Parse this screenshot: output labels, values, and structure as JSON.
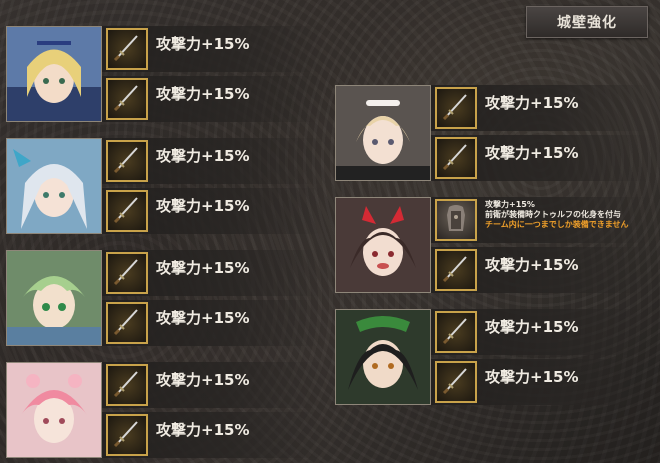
{
  "header": {
    "title": "城壁強化"
  },
  "colors": {
    "accent_gold": "#c8a24a",
    "warning_orange": "#f0a02a",
    "text_light": "#f0ebe2"
  },
  "slot_icon": "sword-icon",
  "left_cards": [
    {
      "name": "blonde-knight",
      "rows": [
        {
          "bonus": "攻撃力+15%"
        },
        {
          "bonus": "攻撃力+15%"
        }
      ]
    },
    {
      "name": "silver-hair-girl",
      "rows": [
        {
          "bonus": "攻撃力+15%"
        },
        {
          "bonus": "攻撃力+15%"
        }
      ]
    },
    {
      "name": "green-hair-girl",
      "rows": [
        {
          "bonus": "攻撃力+15%"
        },
        {
          "bonus": "攻撃力+15%"
        }
      ]
    },
    {
      "name": "pink-hair-girl",
      "rows": [
        {
          "bonus": "攻撃力+15%"
        },
        {
          "bonus": "攻撃力+15%"
        }
      ]
    }
  ],
  "right_cards": [
    {
      "name": "maid-girl",
      "rows": [
        {
          "bonus": "攻撃力+15%"
        },
        {
          "bonus": "攻撃力+15%"
        }
      ]
    },
    {
      "name": "red-horn-girl",
      "special": {
        "line1": "攻撃力+15%",
        "line2": "前衛が装備時クトゥルフの化身を付与",
        "line3": "チーム内に一つまでしか装備できません",
        "icon": "armor-icon"
      },
      "rows": [
        {
          "bonus": ""
        },
        {
          "bonus": "攻撃力+15%"
        }
      ]
    },
    {
      "name": "dark-hair-girl",
      "rows": [
        {
          "bonus": "攻撃力+15%"
        },
        {
          "bonus": "攻撃力+15%"
        }
      ]
    }
  ]
}
